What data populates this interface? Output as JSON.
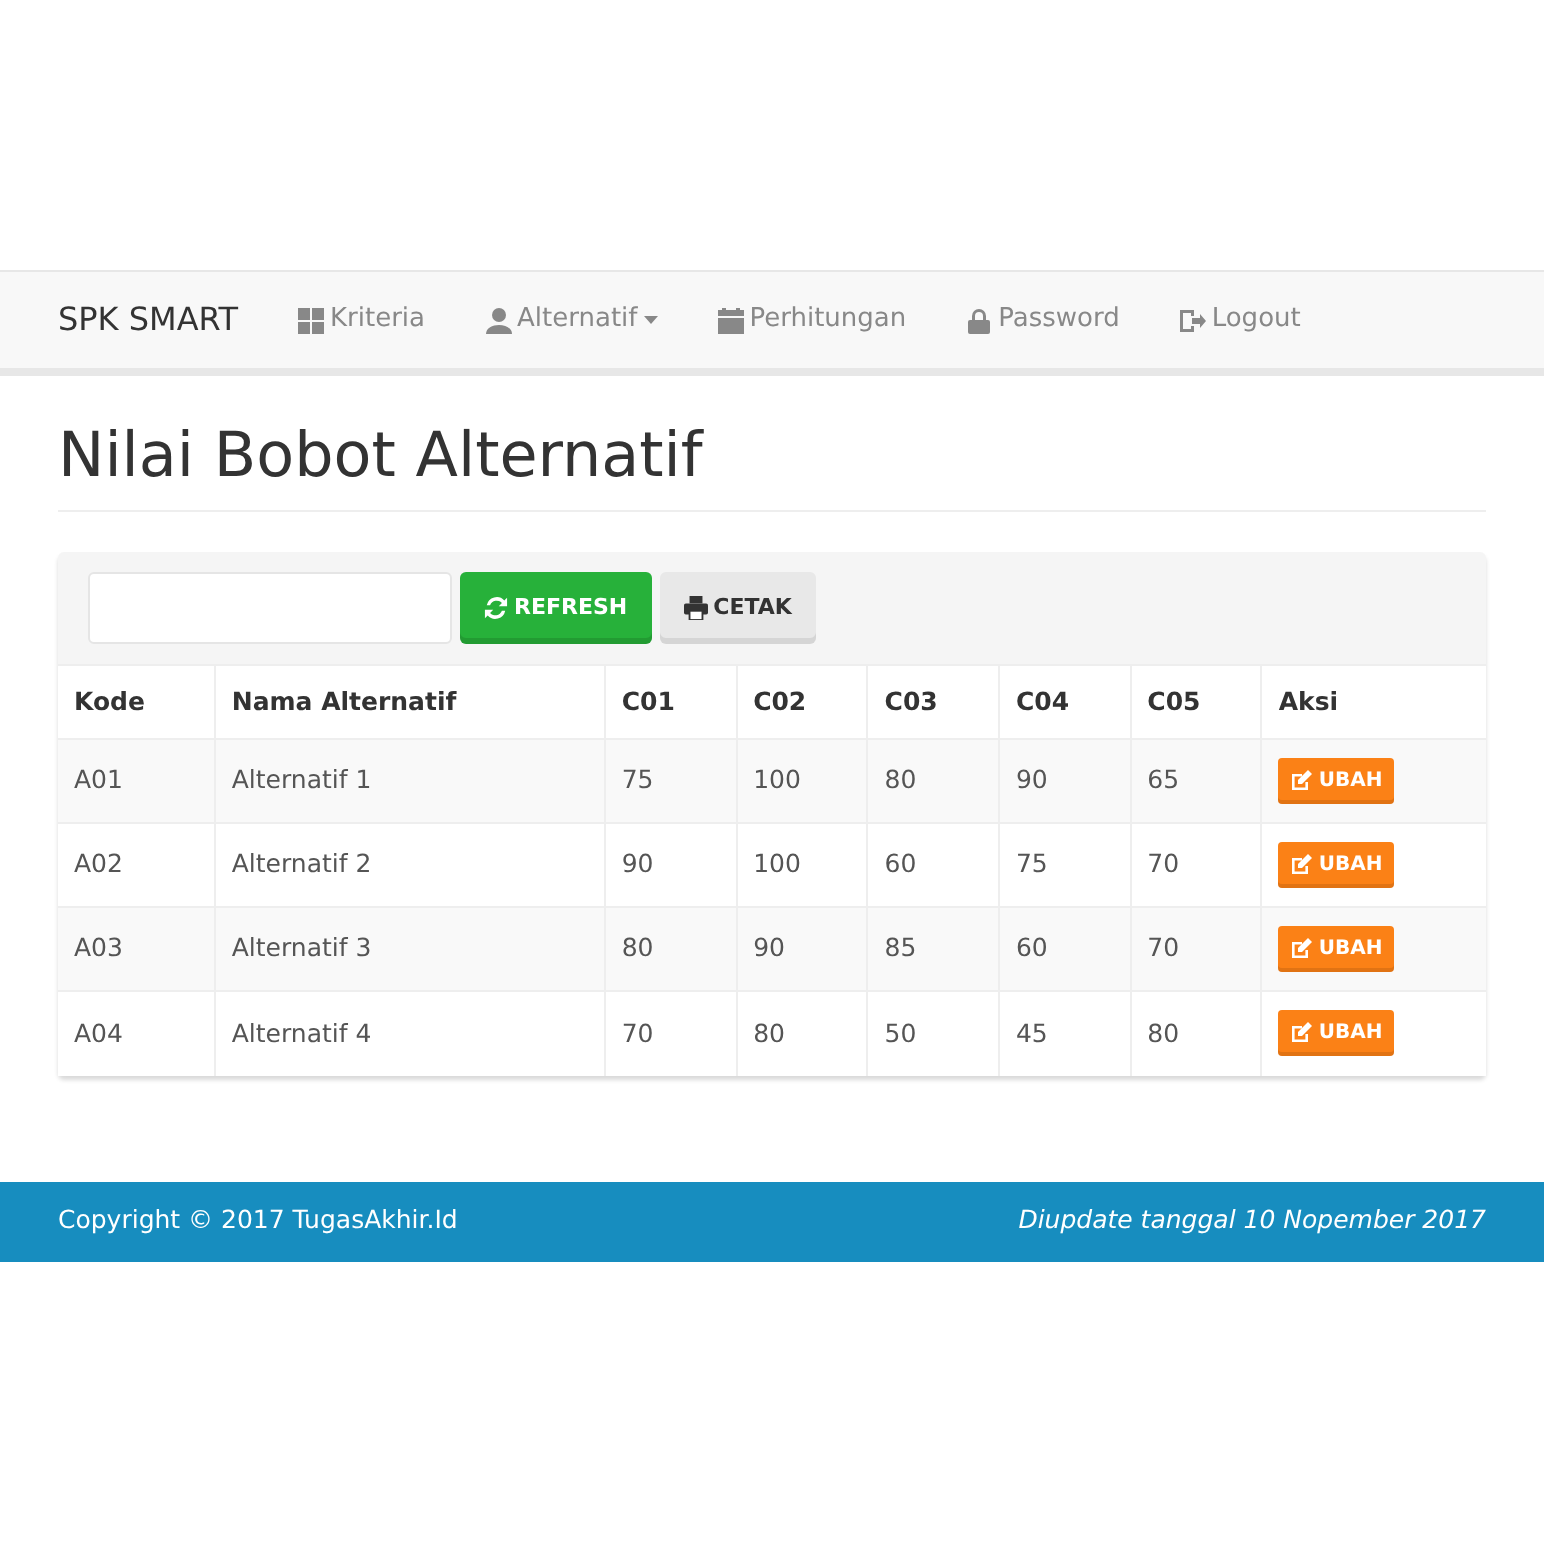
{
  "navbar": {
    "brand": "SPK SMART",
    "items": [
      {
        "label": "Kriteria",
        "dropdown": false
      },
      {
        "label": "Alternatif",
        "dropdown": true
      },
      {
        "label": "Perhitungan",
        "dropdown": false
      },
      {
        "label": "Password",
        "dropdown": false
      },
      {
        "label": "Logout",
        "dropdown": false
      }
    ]
  },
  "page_title": "Nilai Bobot Alternatif",
  "toolbar": {
    "buttons": [
      {
        "label": "REFRESH",
        "kind": "success"
      },
      {
        "label": "CETAK",
        "kind": "default"
      }
    ]
  },
  "table": {
    "columns": [
      "Kode",
      "Nama Alternatif",
      "C01",
      "C02",
      "C03",
      "C04",
      "C05",
      "Aksi"
    ],
    "rows": [
      {
        "cells": [
          "A01",
          "Alternatif 1",
          "75",
          "100",
          "80",
          "90",
          "65"
        ],
        "action": "UBAH"
      },
      {
        "cells": [
          "A02",
          "Alternatif 2",
          "90",
          "100",
          "60",
          "75",
          "70"
        ],
        "action": "UBAH"
      },
      {
        "cells": [
          "A03",
          "Alternatif 3",
          "80",
          "90",
          "85",
          "60",
          "70"
        ],
        "action": "UBAH"
      },
      {
        "cells": [
          "A04",
          "Alternatif 4",
          "70",
          "80",
          "50",
          "45",
          "80"
        ],
        "action": "UBAH"
      }
    ]
  },
  "footer": {
    "left": "Copyright © 2017 TugasAkhir.Id",
    "right": "Diupdate tanggal 10 Nopember 2017"
  }
}
